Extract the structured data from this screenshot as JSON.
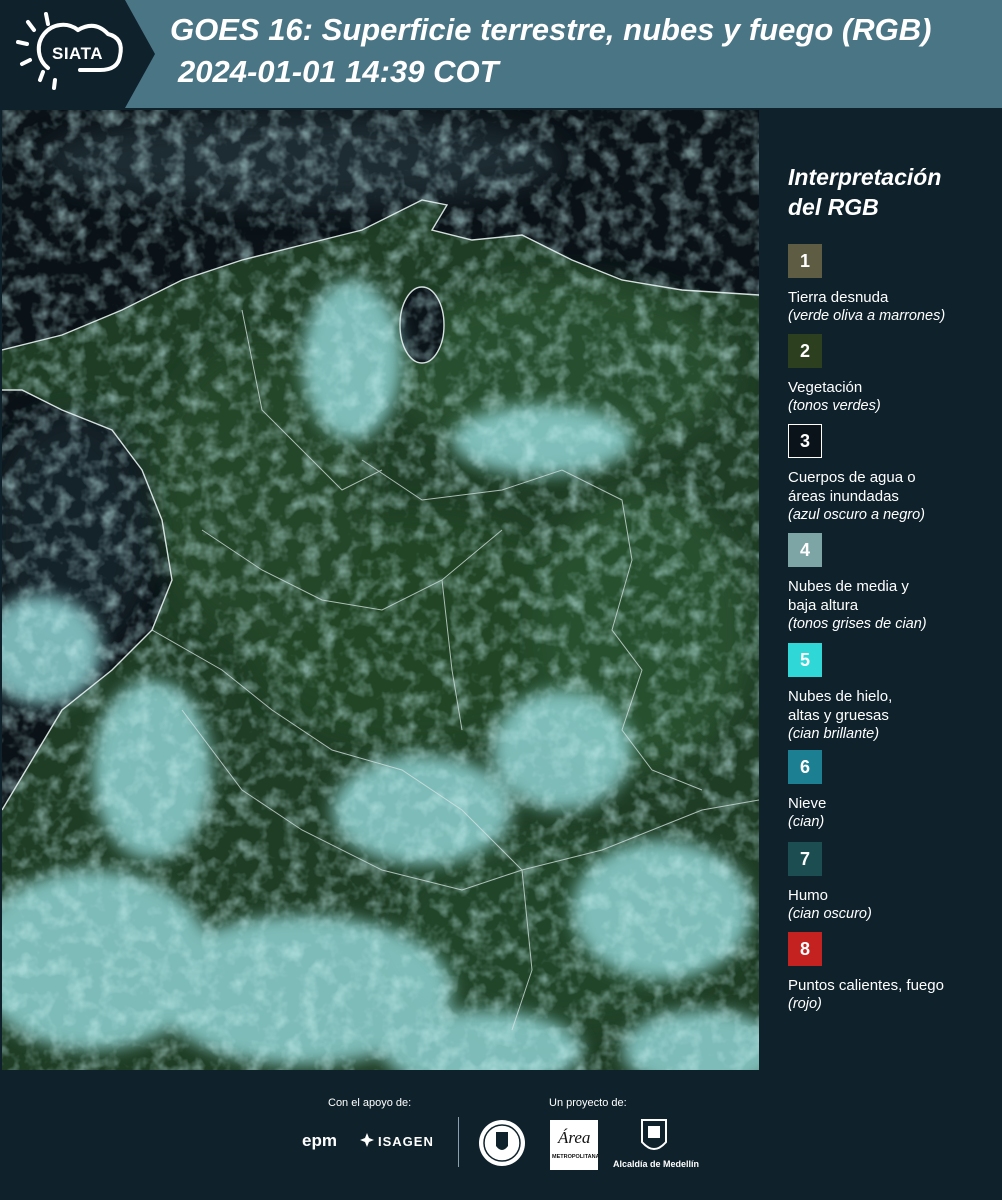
{
  "header": {
    "logo_text": "SIATA",
    "title_line1": "GOES 16: Superficie terrestre, nubes y fuego (RGB)",
    "title_line2": "2024-01-01 14:39 COT"
  },
  "legend": {
    "title_line1": "Interpretación",
    "title_line2": "del RGB",
    "items": [
      {
        "num": "1",
        "color": "#5e5d43",
        "label_lines": [
          "Tierra desnuda"
        ],
        "sub": "(verde oliva a marrones)"
      },
      {
        "num": "2",
        "color": "#2c3f1f",
        "label_lines": [
          "Vegetación"
        ],
        "sub": "(tonos verdes)"
      },
      {
        "num": "3",
        "color": "#0b131a",
        "label_lines": [
          "Cuerpos de agua o",
          "áreas inundadas"
        ],
        "sub": "(azul oscuro a negro)"
      },
      {
        "num": "4",
        "color": "#7ea5a5",
        "label_lines": [
          "Nubes de media y",
          "baja altura"
        ],
        "sub": "(tonos grises de cian)"
      },
      {
        "num": "5",
        "color": "#2fd7d6",
        "label_lines": [
          "Nubes de hielo,",
          "altas y gruesas"
        ],
        "sub": "(cian brillante)"
      },
      {
        "num": "6",
        "color": "#1c7f92",
        "label_lines": [
          "Nieve"
        ],
        "sub": "(cian)"
      },
      {
        "num": "7",
        "color": "#1b4d51",
        "label_lines": [
          "Humo"
        ],
        "sub": "(cian oscuro)"
      },
      {
        "num": "8",
        "color": "#c42121",
        "label_lines": [
          "Puntos calientes, fuego"
        ],
        "sub": "(rojo)"
      }
    ]
  },
  "footer": {
    "support_label": "Con el apoyo de:",
    "project_label": "Un proyecto de:",
    "epm_text": "epm",
    "isagen_text": "ISAGEN",
    "area_text": "Área",
    "area_sub": "METROPOLITANA",
    "alcaldia_text": "Alcaldía de Medellín"
  }
}
